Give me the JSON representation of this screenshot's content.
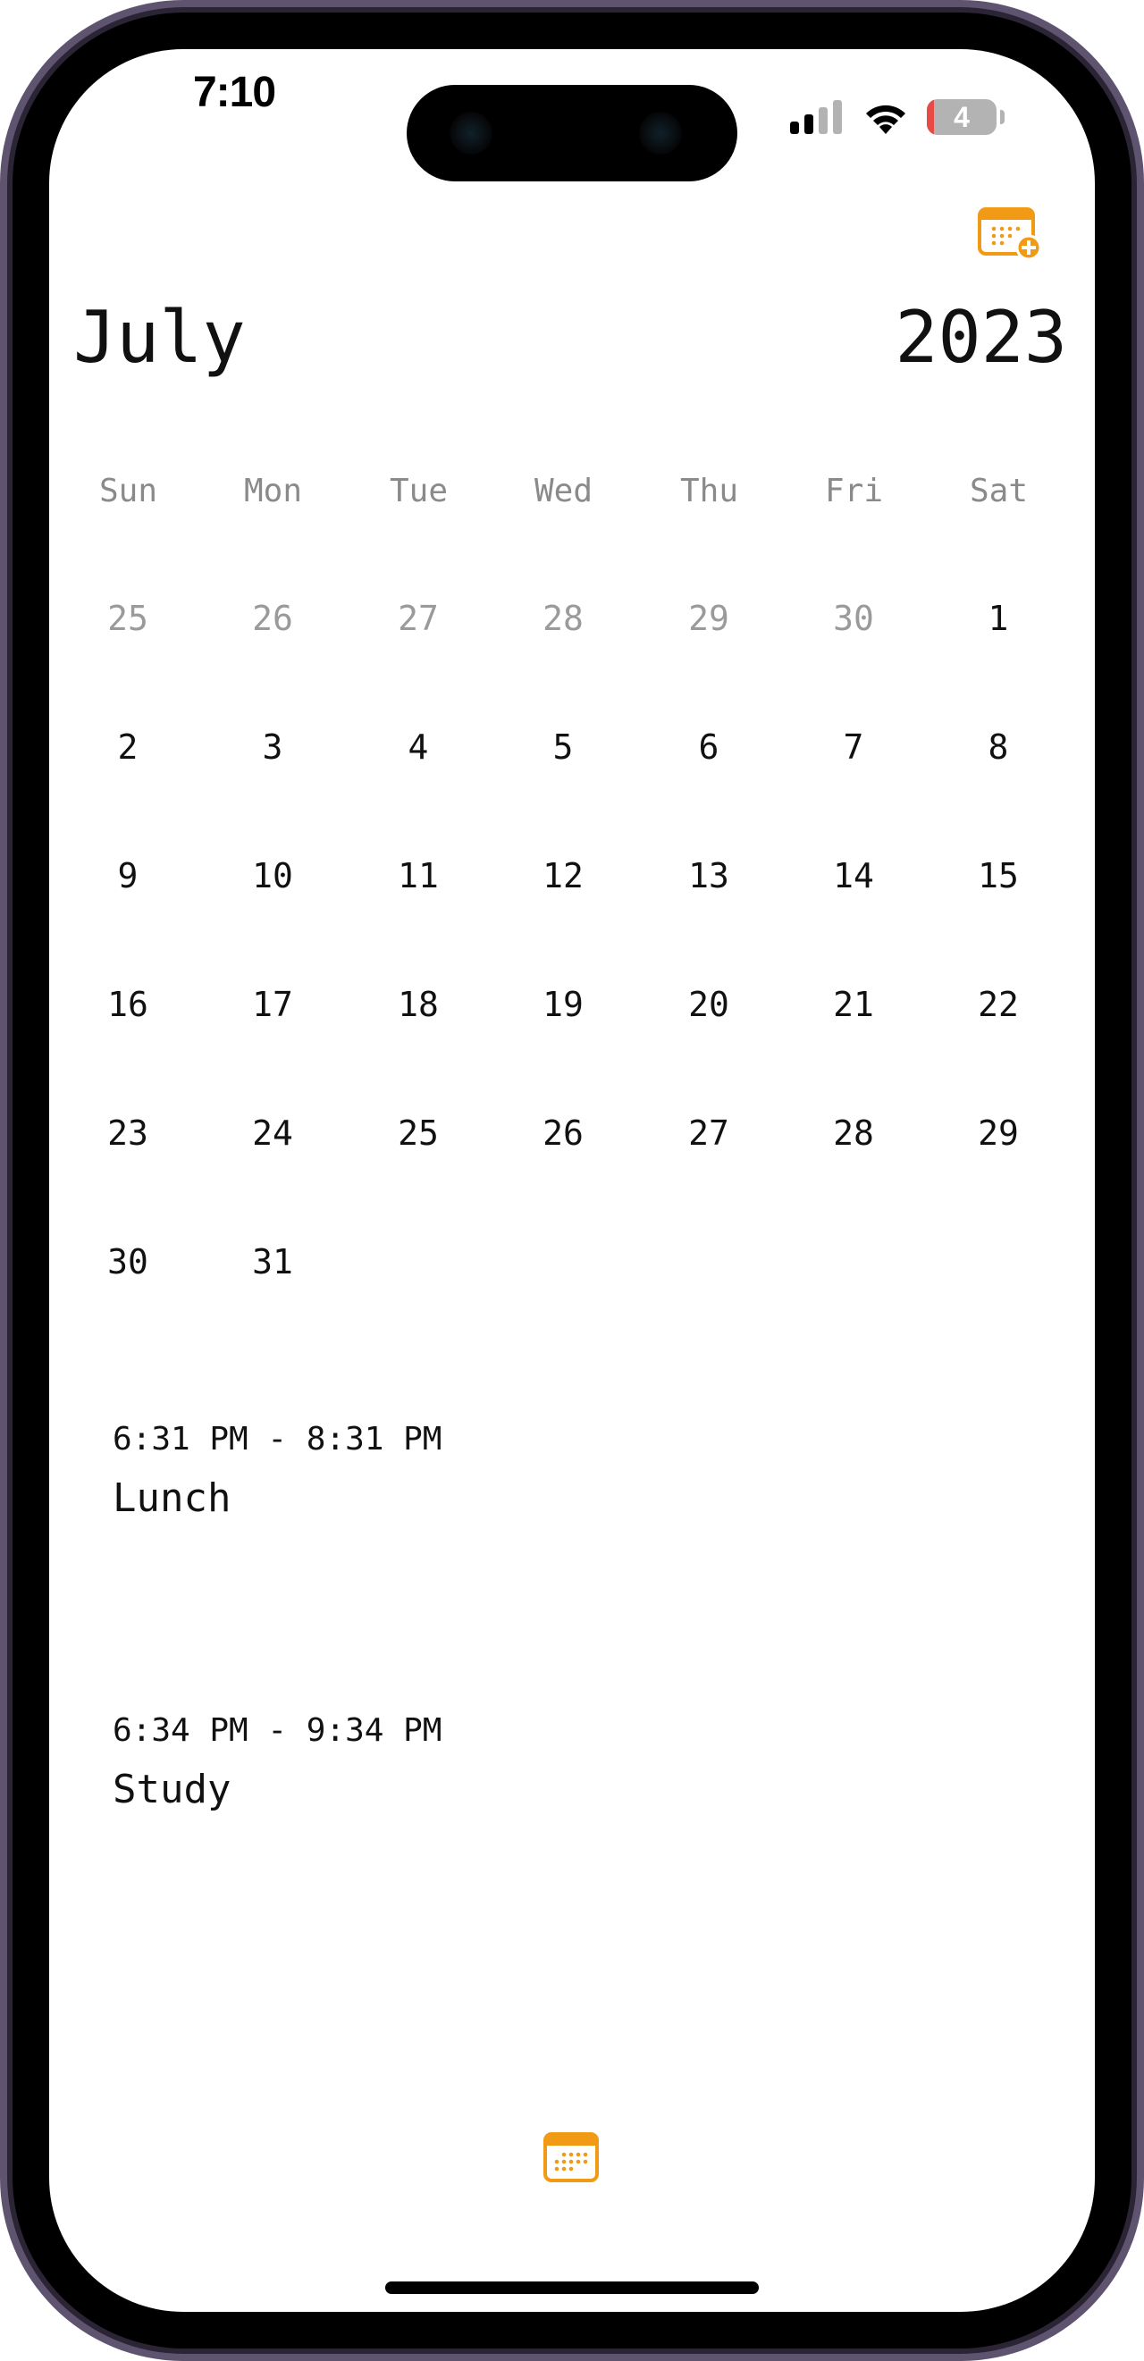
{
  "status_bar": {
    "time": "7:10",
    "battery_level": "4",
    "signal_bars_active": 2,
    "signal_bars_total": 4
  },
  "header": {
    "month": "July",
    "year": "2023",
    "add_event_icon": "calendar-add-icon"
  },
  "weekdays": [
    "Sun",
    "Mon",
    "Tue",
    "Wed",
    "Thu",
    "Fri",
    "Sat"
  ],
  "weeks": [
    [
      {
        "day": "25",
        "in_month": false
      },
      {
        "day": "26",
        "in_month": false
      },
      {
        "day": "27",
        "in_month": false
      },
      {
        "day": "28",
        "in_month": false
      },
      {
        "day": "29",
        "in_month": false
      },
      {
        "day": "30",
        "in_month": false
      },
      {
        "day": "1",
        "in_month": true
      }
    ],
    [
      {
        "day": "2",
        "in_month": true
      },
      {
        "day": "3",
        "in_month": true
      },
      {
        "day": "4",
        "in_month": true
      },
      {
        "day": "5",
        "in_month": true
      },
      {
        "day": "6",
        "in_month": true
      },
      {
        "day": "7",
        "in_month": true
      },
      {
        "day": "8",
        "in_month": true
      }
    ],
    [
      {
        "day": "9",
        "in_month": true
      },
      {
        "day": "10",
        "in_month": true
      },
      {
        "day": "11",
        "in_month": true
      },
      {
        "day": "12",
        "in_month": true
      },
      {
        "day": "13",
        "in_month": true
      },
      {
        "day": "14",
        "in_month": true
      },
      {
        "day": "15",
        "in_month": true
      }
    ],
    [
      {
        "day": "16",
        "in_month": true
      },
      {
        "day": "17",
        "in_month": true
      },
      {
        "day": "18",
        "in_month": true
      },
      {
        "day": "19",
        "in_month": true
      },
      {
        "day": "20",
        "in_month": true
      },
      {
        "day": "21",
        "in_month": true
      },
      {
        "day": "22",
        "in_month": true
      }
    ],
    [
      {
        "day": "23",
        "in_month": true
      },
      {
        "day": "24",
        "in_month": true
      },
      {
        "day": "25",
        "in_month": true
      },
      {
        "day": "26",
        "in_month": true
      },
      {
        "day": "27",
        "in_month": true
      },
      {
        "day": "28",
        "in_month": true
      },
      {
        "day": "29",
        "in_month": true
      }
    ],
    [
      {
        "day": "30",
        "in_month": true
      },
      {
        "day": "31",
        "in_month": true
      }
    ]
  ],
  "events": [
    {
      "time": "6:31 PM - 8:31 PM",
      "title": "Lunch"
    },
    {
      "time": "6:34 PM - 9:34 PM",
      "title": "Study"
    }
  ],
  "tab_bar": {
    "calendar_icon": "calendar-icon"
  },
  "colors": {
    "accent": "#F09A16",
    "text": "#111111",
    "muted_text": "#8A8A8A",
    "frame": "#5F5470",
    "battery_low": "#E84A45"
  }
}
